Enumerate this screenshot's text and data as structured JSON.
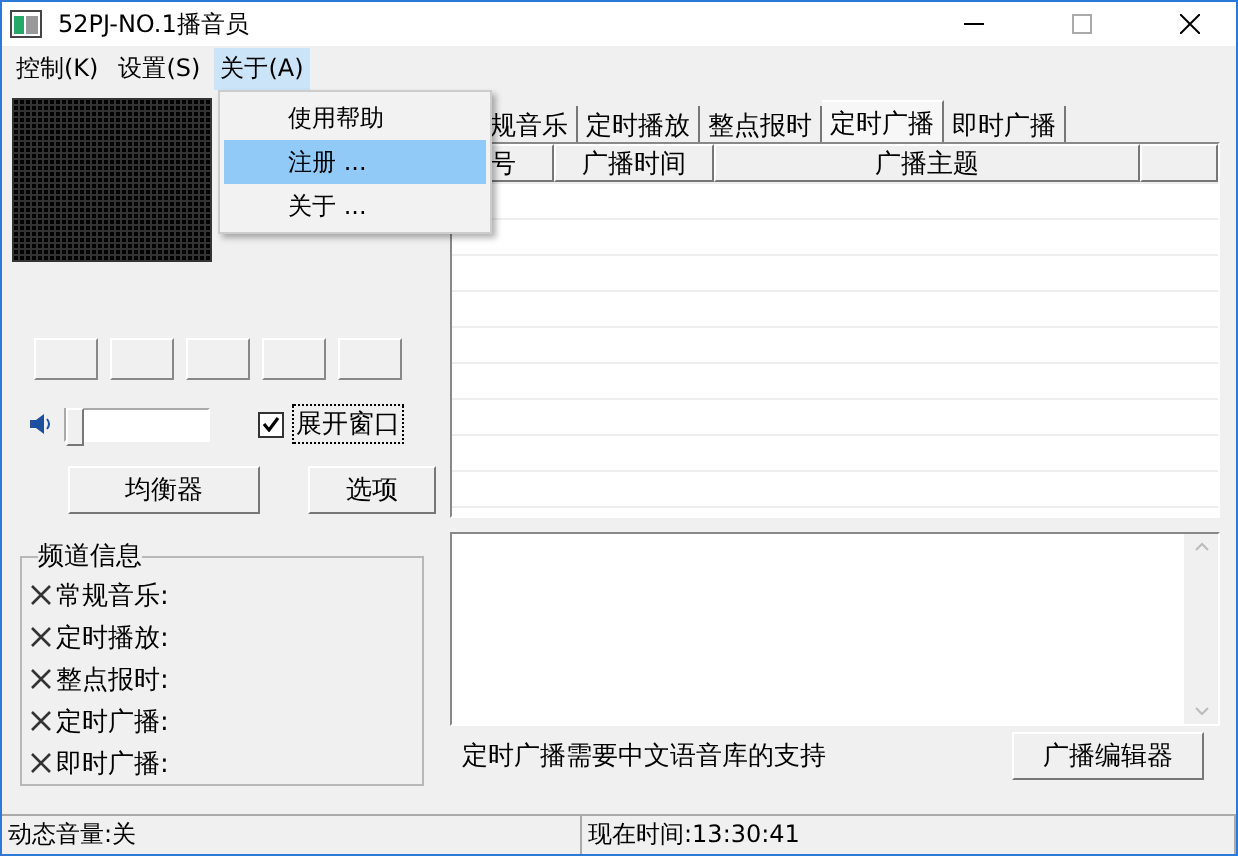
{
  "window": {
    "title": "52PJ-NO.1播音员"
  },
  "menu_bar": [
    {
      "label": "控制(K)",
      "open": false
    },
    {
      "label": "设置(S)",
      "open": false
    },
    {
      "label": "关于(A)",
      "open": true
    }
  ],
  "dropdown": [
    {
      "label": "使用帮助",
      "selected": false
    },
    {
      "label": "注册 ...",
      "selected": true
    },
    {
      "label": "关于 ...",
      "selected": false
    }
  ],
  "volume": {
    "level": 0.0
  },
  "expand_window": {
    "label": "展开窗口",
    "checked": true
  },
  "buttons": [
    "均衡器",
    "选项"
  ],
  "channel_info": {
    "title": "频道信息",
    "items": [
      "常规音乐:",
      "定时播放:",
      "整点报时:",
      "定时广播:",
      "即时广播:"
    ]
  },
  "tabs": [
    {
      "label": "规音乐",
      "selected": false
    },
    {
      "label": "定时播放",
      "selected": false
    },
    {
      "label": "整点报时",
      "selected": false
    },
    {
      "label": "定时广播",
      "selected": true
    },
    {
      "label": "即时广播",
      "selected": false
    }
  ],
  "table": {
    "columns": [
      "号",
      "广播时间",
      "广播主题"
    ]
  },
  "note": "定时广播需要中文语音库的支持",
  "editor_button": "广播编辑器",
  "status_bar": [
    "动态音量:关",
    "现在时间:13:30:41"
  ]
}
